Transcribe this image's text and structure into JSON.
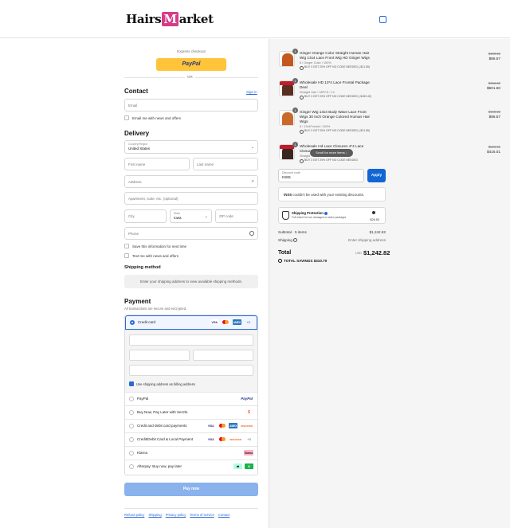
{
  "header": {
    "logo_text": "Hairs",
    "logo_m": "M",
    "logo_suffix": "arket",
    "bag_icon": "shopping-bag-icon"
  },
  "express": {
    "label": "Express checkout",
    "paypal": "PayPal",
    "or": "OR"
  },
  "contact": {
    "title": "Contact",
    "signin": "Sign in",
    "email_placeholder": "Email",
    "email_news": "Email me with news and offers"
  },
  "delivery": {
    "title": "Delivery",
    "country_label": "Country/Region",
    "country_value": "United States",
    "first_name": "First name",
    "last_name": "Last name",
    "address": "Address",
    "apartment": "Apartment, suite, etc. (optional)",
    "city": "City",
    "state_label": "State",
    "state_value": "Iowa",
    "zip": "ZIP code",
    "phone": "Phone",
    "save_info": "Save this information for next time",
    "text_news": "Text me with news and offers"
  },
  "shipping_method": {
    "title": "Shipping method",
    "message": "Enter your shipping address to view available shipping methods."
  },
  "payment": {
    "title": "Payment",
    "subtitle": "All transactions are secure and encrypted.",
    "options": [
      {
        "label": "Credit card",
        "more": "+3"
      },
      {
        "label": "PayPal"
      },
      {
        "label": "Buy Now, Pay Later with Sezzle"
      },
      {
        "label": "Credit and debit card payments"
      },
      {
        "label": "Credit/Debit Card & Local Payment",
        "more": "+3"
      },
      {
        "label": "Klarna"
      },
      {
        "label": "Afterpay: Buy now, pay later"
      }
    ],
    "billing_same": "Use shipping address as billing address",
    "badges": {
      "visa": "VISA",
      "amex": "AMEX",
      "discover": "DISCOVER",
      "klarna": "Klarna",
      "paypal": "PayPal",
      "sezzle": "S"
    },
    "pay_now": "Pay now"
  },
  "footer": {
    "links": [
      "Refund policy",
      "Shipping",
      "Privacy policy",
      "Terms of service",
      "Contact"
    ]
  },
  "cart": {
    "items": [
      {
        "qty": "1",
        "title": "Ginger Orange Color Straight Human Hair Wig 13x4 Lace Front Wig HD Ginger Wigs",
        "variant": "8 / Ginger Color / 150%",
        "discount": "BUY 3 GET 20% OFF NO CODE NEEDED (-$21.65)",
        "price_old": "$108.22",
        "price_new": "$86.57",
        "color": "#c4591f"
      },
      {
        "qty": "1",
        "title": "Wholesale HD 13*4 Lace Frontal Package Deal",
        "variant": "Straight Hair / 18PCS / 14",
        "discount": "BUY 3 GET 20% OFF NO CODE NEEDED (-$150.40)",
        "price_old": "$752.00",
        "price_new": "$601.60",
        "color": "#5a2f22"
      },
      {
        "qty": "1",
        "title": "Ginger Wig 13x4 Body Wave Lace Front Wigs 30 Inch Orange Colored Human Hair Wigs",
        "variant": "8 / 13x4Frontal / 150%",
        "discount": "BUY 3 GET 20% OFF NO CODE NEEDED (-$21.65)",
        "price_old": "$108.22",
        "price_new": "$86.57",
        "color": "#c96a2a"
      },
      {
        "qty": "1",
        "title": "Wholesale Hd Lace Closures 4*4 Lace Closure",
        "variant": "Straight",
        "discount": "BUY 3 GET 20% OFF NO CODE NEEDED",
        "price_old": "$520.01",
        "price_new": "$416.01",
        "color": "#3a2620"
      }
    ],
    "scroll_tip": "Scroll for more items",
    "discount_label": "Discount code",
    "discount_value": "INS5",
    "apply": "Apply",
    "discount_error_code": "INS5",
    "discount_error_text": " couldn't be used with your existing discounts.",
    "protection_title": "Shipping Protection",
    "protection_desc": "Full refund for lost, damaged or stolen packages",
    "protection_price": "$26.53",
    "subtotal_label": "Subtotal · 5 items",
    "subtotal_value": "$1,242.82",
    "shipping_label": "Shipping",
    "shipping_value": "Enter shipping address",
    "total_label": "Total",
    "total_currency": "USD",
    "total_value": "$1,242.82",
    "savings": "TOTAL SAVINGS $310.70"
  }
}
